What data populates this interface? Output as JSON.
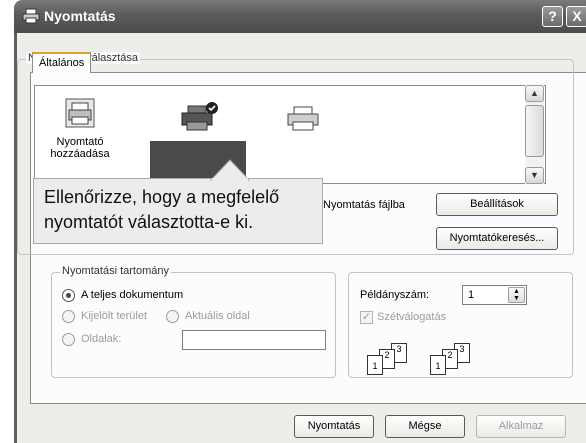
{
  "window": {
    "title": "Nyomtatás",
    "help_label": "?",
    "close_label": "X"
  },
  "tabs": [
    {
      "label": "Általános"
    }
  ],
  "printer_select": {
    "group_title": "Nyomtató kiválasztása",
    "add_printer_label_line1": "Nyomtató",
    "add_printer_label_line2": "hozzáadása",
    "print_to_file": "Nyomtatás fájlba",
    "settings_button": "Beállítások",
    "find_printer_button": "Nyomtatókeresés..."
  },
  "callout": {
    "line1": "Ellenőrizze, hogy a megfelelő",
    "line2": "nyomtatót választotta-e ki."
  },
  "print_range": {
    "group_title": "Nyomtatási tartomány",
    "all_document": "A teljes dokumentum",
    "selection": "Kijelölt terület",
    "current_page": "Aktuális oldal",
    "pages": "Oldalak:",
    "pages_value": "",
    "selected_option": "all_document"
  },
  "copies": {
    "label": "Példányszám:",
    "value": "1",
    "collate_label": "Szétválogatás",
    "collate_checked": true,
    "page_labels": [
      "1",
      "2",
      "3"
    ]
  },
  "buttons": {
    "print": "Nyomtatás",
    "cancel": "Mégse",
    "apply": "Alkalmaz"
  },
  "icons": [
    "printer-icon",
    "add-printer-icon",
    "help-icon",
    "close-icon"
  ]
}
